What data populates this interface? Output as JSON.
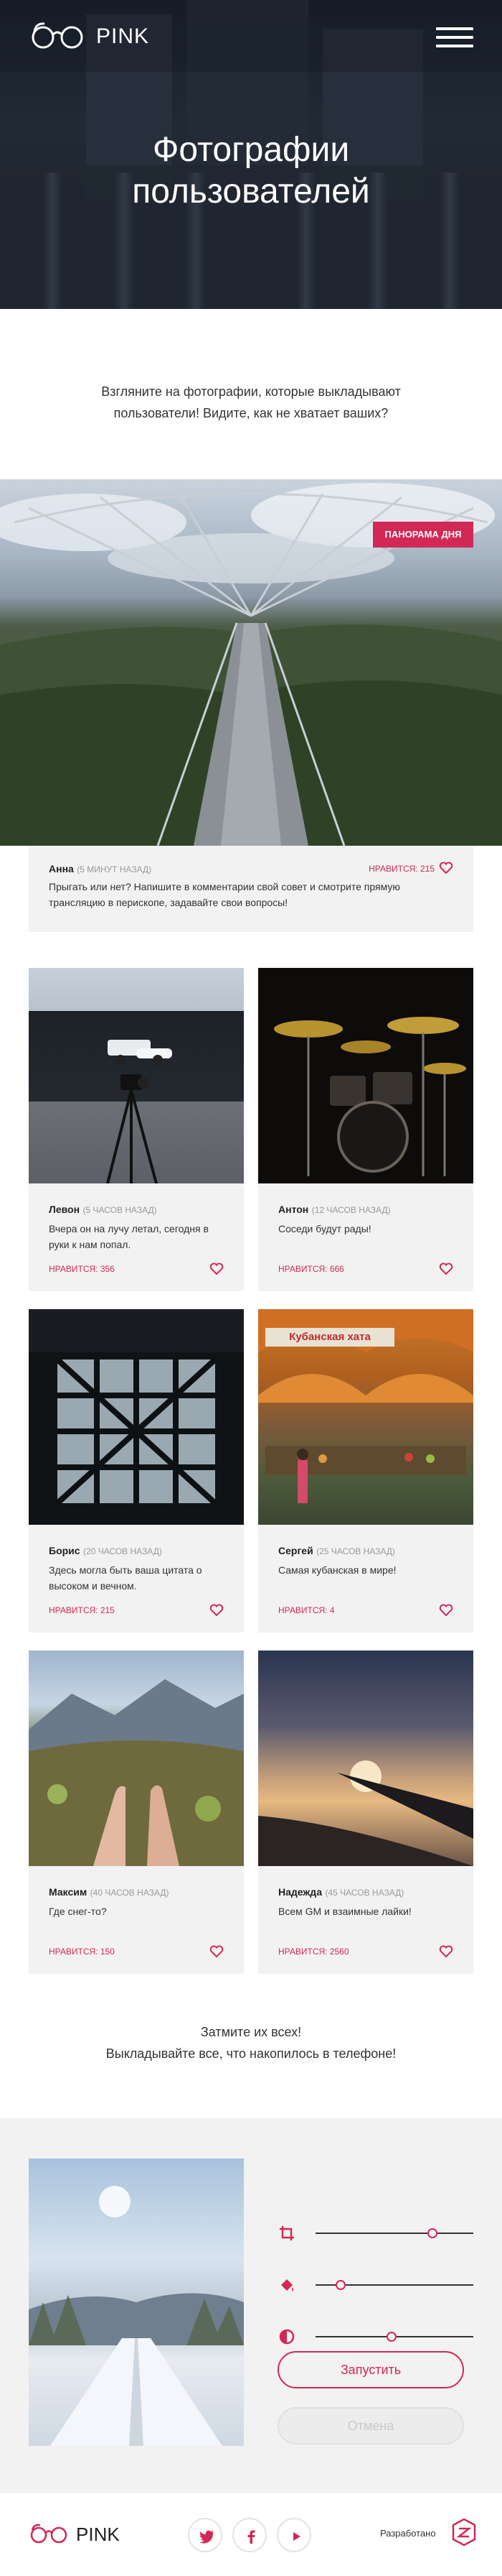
{
  "header": {
    "logo_text": "PINK",
    "menu_icon": "hamburger-icon"
  },
  "hero": {
    "title": "Фотографии пользователей"
  },
  "intro": {
    "text": "Взгляните на фотографии, которые выкладывают пользователи! Видите, как не хватает ваших?"
  },
  "panorama": {
    "tag": "Панорама дня",
    "author": "Анна",
    "ago": "(5 минут назад)",
    "likes": "Нравится: 215",
    "caption": "Прыгать или нет? Напишите в комментарии свой совет и смотрите прямую трансляцию в перископе, задавайте свои вопросы!"
  },
  "gallery": [
    {
      "author": "Левон",
      "ago": "(5 часов назад)",
      "caption": "Вчера он на лучу летал, сегодня в руки к нам попал.",
      "likes": "Нравится: 356"
    },
    {
      "author": "Антон",
      "ago": "(12 часов назад)",
      "caption": "Соседи будут рады!",
      "likes": "Нравится: 666"
    },
    {
      "author": "Борис",
      "ago": "(20 часов назад)",
      "caption": "Здесь могла быть ваша цитата о высоком и вечном.",
      "likes": "Нравится: 215"
    },
    {
      "author": "Сергей",
      "ago": "(25 часов назад)",
      "caption": "Самая кубанская в мире!",
      "likes": "Нравится: 4"
    },
    {
      "author": "Максим",
      "ago": "(40 часов назад)",
      "caption": "Где снег-то?",
      "likes": "Нравится: 150"
    },
    {
      "author": "Надежда",
      "ago": "(45 часов назад)",
      "caption": "Всем GM и взаимные лайки!",
      "likes": "Нравится: 2560"
    }
  ],
  "sign_board_text": "Кубанская хата",
  "cta": {
    "line1": "Затмите их всех!",
    "line2": "Выкладывайте все, что накопилось в телефоне!"
  },
  "editor": {
    "tools": [
      {
        "icon": "crop-icon",
        "level": 0.74
      },
      {
        "icon": "fill-icon",
        "level": 0.16
      },
      {
        "icon": "contrast-icon",
        "level": 0.48
      }
    ],
    "apply_label": "Запустить",
    "cancel_label": "Отмена"
  },
  "footer": {
    "logo_text": "PINK",
    "social": [
      "twitter-icon",
      "facebook-icon",
      "youtube-icon"
    ],
    "developed_by": "Разработано",
    "accent": "#d22856"
  }
}
